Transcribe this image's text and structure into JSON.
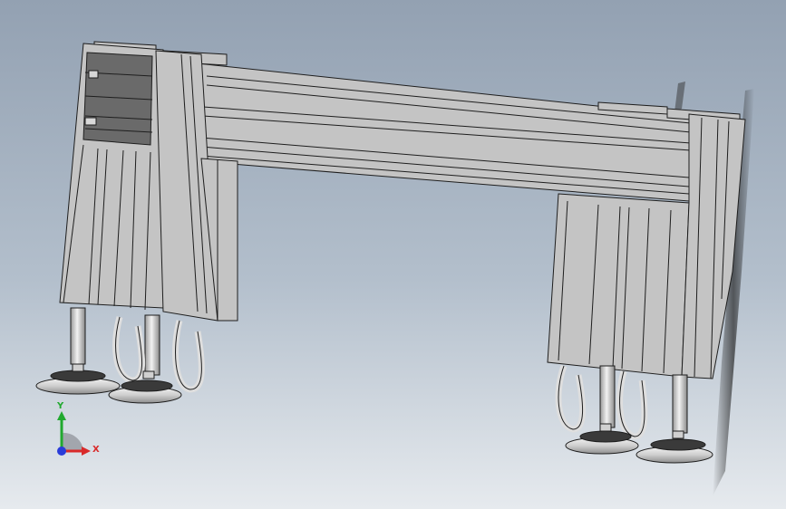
{
  "viewport": {
    "background_top": "#93a1b2",
    "background_bottom": "#e6eaee"
  },
  "model": {
    "part_color": "#c4c4c4",
    "edge_color": "#1e1e1e",
    "dark_face_color": "#6a6a6a",
    "foot_color": "#dedede"
  },
  "triad": {
    "x_label": "X",
    "y_label": "Y",
    "x_color": "#d92a2a",
    "y_color": "#21a92f",
    "z_color": "#2a3cd9"
  }
}
